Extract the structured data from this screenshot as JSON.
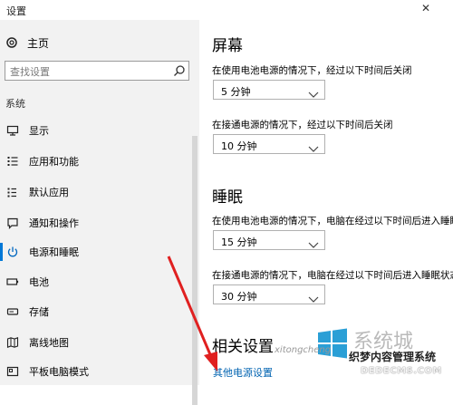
{
  "window": {
    "title": "设置",
    "close": "✕"
  },
  "sidebar": {
    "home_label": "主页",
    "search_placeholder": "查找设置",
    "section_label": "系统",
    "items": [
      {
        "label": "显示",
        "icon": "display-icon"
      },
      {
        "label": "应用和功能",
        "icon": "apps-icon"
      },
      {
        "label": "默认应用",
        "icon": "default-apps-icon"
      },
      {
        "label": "通知和操作",
        "icon": "notification-icon"
      },
      {
        "label": "电源和睡眠",
        "icon": "power-icon",
        "active": true
      },
      {
        "label": "电池",
        "icon": "battery-icon"
      },
      {
        "label": "存储",
        "icon": "storage-icon"
      },
      {
        "label": "离线地图",
        "icon": "map-icon"
      },
      {
        "label": "平板电脑模式",
        "icon": "tablet-icon"
      }
    ]
  },
  "screen": {
    "heading": "屏幕",
    "battery_desc": "在使用电池电源的情况下，经过以下时间后关闭",
    "battery_value": "5 分钟",
    "plugged_desc": "在接通电源的情况下，经过以下时间后关闭",
    "plugged_value": "10 分钟"
  },
  "sleep": {
    "heading": "睡眠",
    "battery_desc": "在使用电池电源的情况下，电脑在经过以下时间后进入睡眠",
    "battery_value": "15 分钟",
    "plugged_desc": "在接通电源的情况下，电脑在经过以下时间后进入睡眠状态",
    "plugged_value": "30 分钟"
  },
  "related": {
    "heading": "相关设置",
    "link": "其他电源设置"
  },
  "watermark": {
    "title": "系统城",
    "subtitle": "织梦内容管理系统",
    "url": "DEDECMS.COM",
    "small": "xitongcheng"
  },
  "colors": {
    "accent": "#0078d7",
    "link": "#0063b1",
    "arrow": "#e02020",
    "sidebar_bg": "#f2f2f2"
  }
}
